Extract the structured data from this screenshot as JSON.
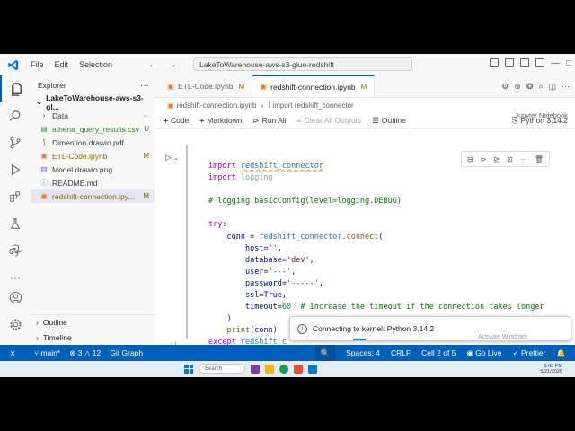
{
  "menu": [
    "File",
    "Edit",
    "Selection"
  ],
  "command_center": "LakeToWarehouse-aws-s3-glue-redshift",
  "explorer": {
    "title": "Explorer",
    "root": "LakeToWarehouse-aws-s3-gl...",
    "files": [
      {
        "name": "Data",
        "icon": "folder-icon",
        "badge": ""
      },
      {
        "name": "athena_query_results.csv",
        "icon": "csv-file-icon",
        "badge": "U"
      },
      {
        "name": "Dimention.drawio.pdf",
        "icon": "pdf-file-icon",
        "badge": ""
      },
      {
        "name": "ETL-Code.ipynb",
        "icon": "notebook-file-icon",
        "badge": "M"
      },
      {
        "name": "Model.drawio.png",
        "icon": "image-file-icon",
        "badge": ""
      },
      {
        "name": "README.md",
        "icon": "markdown-file-icon",
        "badge": ""
      },
      {
        "name": "redshift-connection.ipy...",
        "icon": "notebook-file-icon",
        "badge": "M"
      }
    ],
    "outline": "Outline",
    "timeline": "Timeline"
  },
  "tabs": [
    {
      "label": "ETL-Code.ipynb",
      "mod": "M"
    },
    {
      "label": "redshift-connection.ipynb",
      "mod": "M"
    }
  ],
  "breadcrumb": [
    "redshift-connection.ipynb",
    "import redshift_connector"
  ],
  "kernel_picker": "Jupyter Notebook",
  "toolbar": {
    "code": "Code",
    "markdown": "Markdown",
    "run_all": "Run All",
    "clear_all": "Clear All Outputs",
    "outline": "Outline",
    "kernel": "Python 3.14.2"
  },
  "code_lines": [
    "import redshift_connector",
    "import logging",
    "",
    "# logging.basicConfig(level=logging.DEBUG)",
    "",
    "try:",
    "    conn = redshift_connector.connect(",
    "        host='',",
    "        database='dev',",
    "        user='---',",
    "        password='-----',",
    "        ssl=True,",
    "        timeout=60  # Increase the timeout if the connection takes longer",
    "    )",
    "    print(conn)",
    "except redshift_c"
  ],
  "cell_bracket": "[ ]",
  "notification": "Connecting to kernel: Python 3.14.2",
  "watermark": "Activate Windows",
  "status": {
    "branch": "main*",
    "errors": "3",
    "warnings": "12",
    "git_graph": "Git Graph",
    "spaces": "Spaces: 4",
    "eol": "CRLF",
    "cell": "Cell 2 of 5",
    "golive": "Go Live",
    "prettier": "Prettier"
  },
  "taskbar": {
    "search": "Search",
    "time": "6:43 PM",
    "date": "5/21/2026"
  },
  "colors": {
    "accent": "#005fb8",
    "statusbar": "#005fb8",
    "keyword": "#af00db",
    "string": "#a31515",
    "comment": "#008000"
  }
}
